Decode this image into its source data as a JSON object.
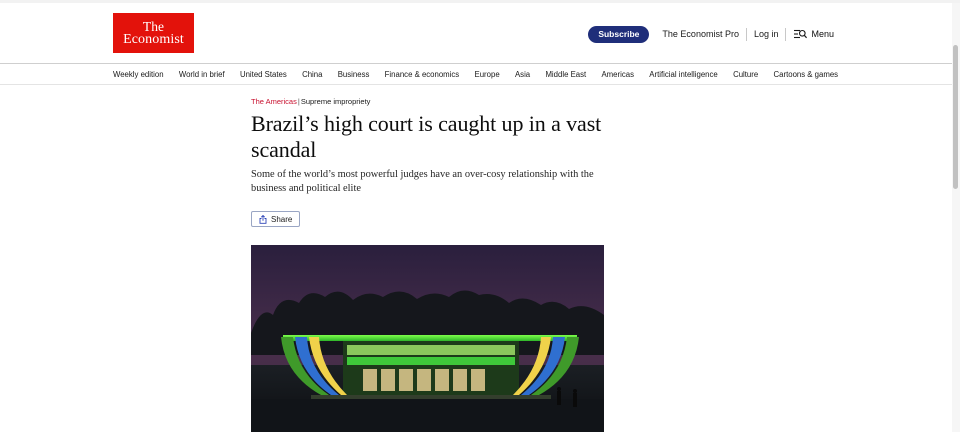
{
  "header": {
    "logo_line1": "The",
    "logo_line2": "Economist",
    "subscribe_label": "Subscribe",
    "pro_label": "The Economist Pro",
    "login_label": "Log in",
    "menu_label": "Menu"
  },
  "nav": {
    "items": [
      "Weekly edition",
      "World in brief",
      "United States",
      "China",
      "Business",
      "Finance & economics",
      "Europe",
      "Asia",
      "Middle East",
      "Americas",
      "Artificial intelligence",
      "Culture",
      "Cartoons & games"
    ]
  },
  "article": {
    "section": "The Americas",
    "rubric": "Supreme impropriety",
    "headline": "Brazil’s high court is caught up in a vast scandal",
    "standfirst": "Some of the world’s most powerful judges have an over-cosy relationship with the business and political elite",
    "share_label": "Share"
  },
  "colors": {
    "brand_red": "#e3120b",
    "subscribe_bg": "#1f2e7a",
    "section_red": "#c8102e"
  }
}
